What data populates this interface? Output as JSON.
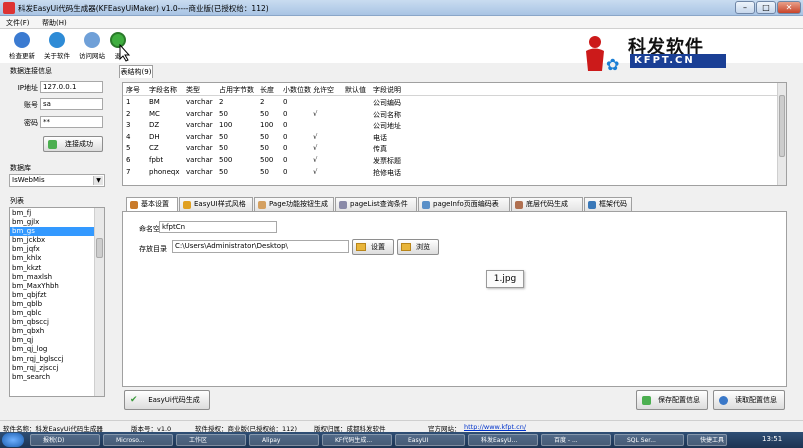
{
  "window": {
    "title": "科发EasyUi代码生成器(KFEasyUiMaker) v1.0----商业版(已授权给：112)",
    "minimize": "–",
    "maximize": "□",
    "close": "✕"
  },
  "menu": [
    "文件(F)",
    "帮助(H)"
  ],
  "toolbar": [
    {
      "label": "检查更新",
      "icon": "download-icon",
      "color": "#3b7bd1"
    },
    {
      "label": "关于软件",
      "icon": "help-icon",
      "color": "#2e8bd6"
    },
    {
      "label": "访问网站",
      "icon": "globe-icon",
      "color": "#6fa0d8"
    },
    {
      "label": "退",
      "icon": "exit-icon",
      "color": "#3fae3f"
    }
  ],
  "logo": {
    "cn": "科发软件",
    "en": "KFPT.CN"
  },
  "db_panel": {
    "heading": "数据连接信息",
    "ip_label": "IP地址",
    "ip_value": "127.0.0.1",
    "account_label": "账号",
    "account_value": "sa",
    "password_label": "密码",
    "password_value": "**",
    "connect_button": "连接成功"
  },
  "database": {
    "label": "数据库",
    "selected": "IsWebMis"
  },
  "table_list": {
    "label": "列表",
    "items": [
      "bm_fj",
      "bm_gjlx",
      "bm_gs",
      "bm_jckbx",
      "bm_jqfx",
      "bm_khlx",
      "bm_kkzt",
      "bm_maxlsh",
      "bm_MaxYhbh",
      "bm_qbjfzt",
      "bm_qblb",
      "bm_qblc",
      "bm_qbsccj",
      "bm_qbxh",
      "bm_qj",
      "bm_qj_log",
      "bm_rqj_bglsccj",
      "bm_rqj_zjsccj",
      "bm_search"
    ],
    "selected_index": 2
  },
  "table_structure": {
    "tab_label": "表结构(9)",
    "headers": [
      "序号",
      "字段名称",
      "类型",
      "占用字节数",
      "长度",
      "小数位数",
      "允许空",
      "默认值",
      "字段说明"
    ],
    "rows": [
      [
        "1",
        "BM",
        "varchar",
        "2",
        "2",
        "0",
        "",
        "",
        "公司编码"
      ],
      [
        "2",
        "MC",
        "varchar",
        "50",
        "50",
        "0",
        "√",
        "",
        "公司名称"
      ],
      [
        "3",
        "DZ",
        "varchar",
        "100",
        "100",
        "0",
        "",
        "",
        "公司地址"
      ],
      [
        "4",
        "DH",
        "varchar",
        "50",
        "50",
        "0",
        "√",
        "",
        "电话"
      ],
      [
        "5",
        "CZ",
        "varchar",
        "50",
        "50",
        "0",
        "√",
        "",
        "传真"
      ],
      [
        "6",
        "fpbt",
        "varchar",
        "500",
        "500",
        "0",
        "√",
        "",
        "发票标题"
      ],
      [
        "7",
        "phoneqx",
        "varchar",
        "50",
        "50",
        "0",
        "√",
        "",
        "抢修电话"
      ]
    ]
  },
  "config_tabs": [
    {
      "label": "基本设置",
      "color": "#c97b2a"
    },
    {
      "label": "EasyUI样式风格",
      "color": "#e0a020"
    },
    {
      "label": "Page功能按钮生成",
      "color": "#d4a060"
    },
    {
      "label": "pageList查询条件",
      "color": "#8a8aa8"
    },
    {
      "label": "pageInfo页面编码表",
      "color": "#5a90c8"
    },
    {
      "label": "底层代码生成",
      "color": "#b07050"
    },
    {
      "label": "框架代码",
      "color": "#3a78b8"
    }
  ],
  "basic_settings": {
    "namespace_label": "命名空间",
    "namespace_value": "kfptCn",
    "save_dir_label": "存放目录",
    "save_dir_value": "C:\\Users\\Administrator\\Desktop\\",
    "set_button": "设置",
    "browse_button": "浏览"
  },
  "overlay_caption": "1.jpg",
  "bottom_buttons": {
    "generate": "EasyUi代码生成",
    "save_config": "保存配置信息",
    "read_config": "读取配置信息"
  },
  "status": {
    "software_name": "软件名称：科发EasyUi代码生成器",
    "version": "版本号：v1.0",
    "license": "软件授权：商业版(已授权给：112)",
    "copyright": "版权归属：成都科发软件",
    "website_label": "官方网站：",
    "website": "http://www.kfpt.cn/"
  },
  "taskbar": [
    "报税(D)",
    "Microso...",
    "工作区",
    "Alipay",
    "KF代码生成...",
    "EasyUI",
    "科发EasyU...",
    "百度 - ...",
    "SQL Ser...",
    "快捷工具"
  ],
  "clock": "13:51"
}
